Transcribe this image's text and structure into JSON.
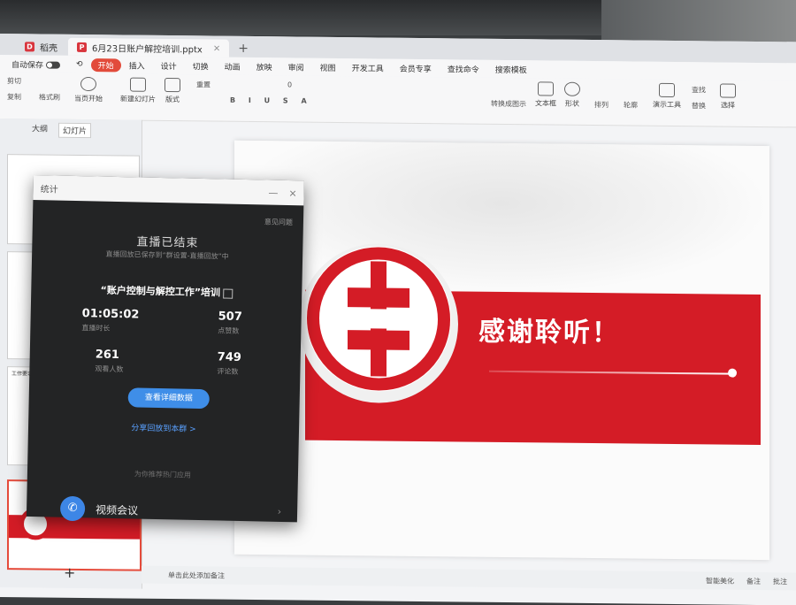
{
  "tabs": [
    {
      "label": "稻壳",
      "active": false
    },
    {
      "label": "6月23日账户解控培训.pptx",
      "active": true
    }
  ],
  "menu": {
    "autosave": "自动保存",
    "items": [
      "开始",
      "插入",
      "设计",
      "切换",
      "动画",
      "放映",
      "审阅",
      "视图",
      "开发工具",
      "会员专享"
    ],
    "active": "开始",
    "search": "查找命令",
    "extra": "搜索模板"
  },
  "ribbon": {
    "clipboard": [
      "剪切",
      "复制",
      "格式刷"
    ],
    "play_from_current": "当页开始",
    "new_slide": "新建幻灯片",
    "layout": "版式",
    "reset": "重置",
    "font_size": "0",
    "convert_to_smartart": "转换成图示",
    "text_box": "文本框",
    "shape": "形状",
    "arrange": "排列",
    "outline": "轮廓",
    "find": "查找",
    "replace": "替换",
    "select": "选择",
    "presentation_tools": "演示工具"
  },
  "left_panel": {
    "tabs": [
      "大纲",
      "幻灯片"
    ],
    "thumb_text": "工作要求："
  },
  "slide": {
    "thanks": "感谢聆听！"
  },
  "statusbar": {
    "note": "单击此处添加备注",
    "smart_beautify": "智能美化",
    "notes": "备注",
    "comments": "批注"
  },
  "dialog": {
    "title": "统计",
    "feedback": "意见问题",
    "status": "直播已结束",
    "saved_msg": "直播回放已保存到“群设置-直播回放”中",
    "course": "“账户控制与解控工作”培训",
    "stats": {
      "duration_value": "01:05:02",
      "duration_label": "直播时长",
      "likes_value": "507",
      "likes_label": "点赞数",
      "viewers_value": "261",
      "viewers_label": "观看人数",
      "comments_value": "749",
      "comments_label": "评论数"
    },
    "detail_button": "查看详细数据",
    "share_link": "分享回放到本群 >",
    "record_tip": "为你推荐热门应用",
    "video_conf": "视频会议"
  },
  "colors": {
    "brand_red": "#d41c26",
    "accent_blue": "#3f8ee8",
    "dialog_bg": "#232425"
  }
}
